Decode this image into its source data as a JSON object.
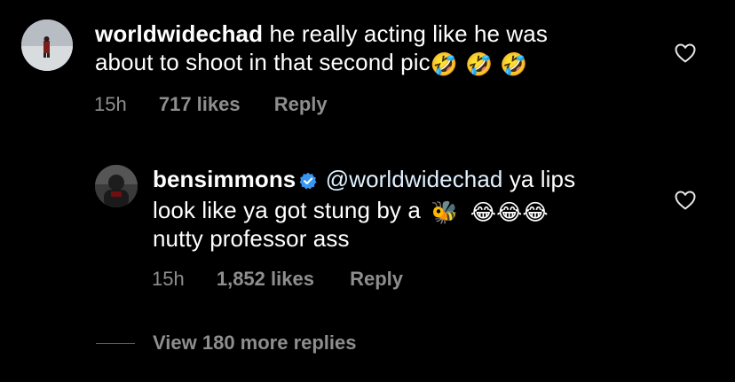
{
  "comment1": {
    "username": "worldwidechad",
    "text_line1": "he really acting like he was",
    "text_line2": "about to shoot in that second pic",
    "emojis": "🤣 🤣 🤣",
    "time": "15h",
    "likes": "717 likes",
    "reply_label": "Reply",
    "avatar_icon": "person-in-snow-avatar",
    "like_icon": "heart-outline-icon"
  },
  "comment2": {
    "username": "bensimmons",
    "verified_icon": "verified-badge-icon",
    "mention": "@worldwidechad",
    "text_part1": "ya lips",
    "text_line2": "look like ya got stung by a",
    "emojis_bee": "🐝",
    "emojis_laugh": "😂😂😂",
    "text_line3": "nutty professor ass",
    "time": "15h",
    "likes": "1,852 likes",
    "reply_label": "Reply",
    "avatar_icon": "profile-photo-avatar",
    "like_icon": "heart-outline-icon"
  },
  "view_replies": {
    "label": "View 180 more replies"
  },
  "colors": {
    "background": "#000000",
    "primary_text": "#ffffff",
    "secondary_text": "#8e8e8e",
    "verified": "#3897f0"
  }
}
